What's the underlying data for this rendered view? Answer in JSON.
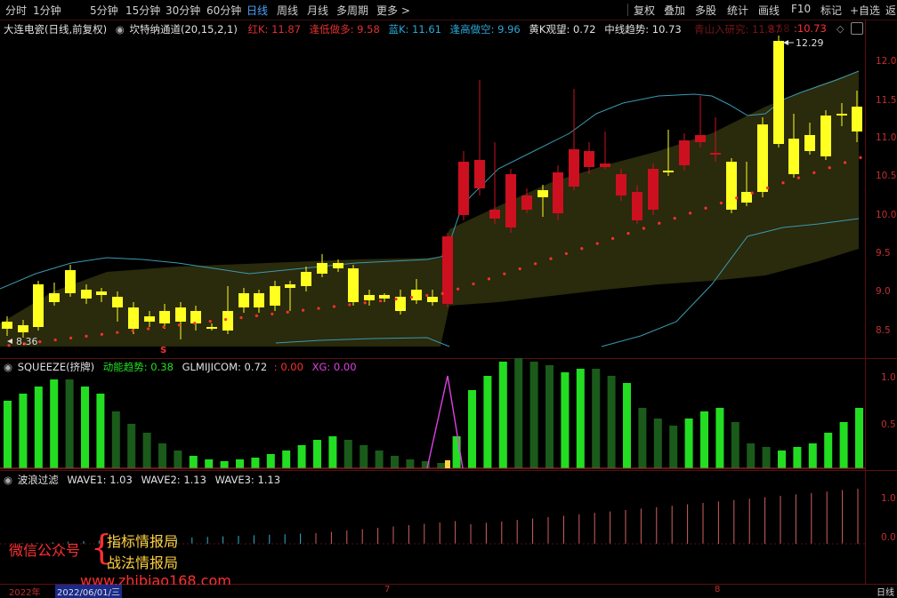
{
  "toolbar": {
    "left_tabs": [
      "分时",
      "1分钟",
      "5分钟",
      "15分钟",
      "30分钟",
      "60分钟",
      "日线",
      "周线",
      "月线",
      "多周期",
      "更多 >"
    ],
    "active_tab": "日线",
    "right_tabs": [
      "复权",
      "叠加",
      "多股",
      "统计",
      "画线",
      "F10",
      "标记",
      "+自选",
      "返"
    ]
  },
  "main_panel": {
    "title": "大连电瓷(日线,前复权)",
    "indicator": "坎特纳通道(20,15,2,1)",
    "values": [
      {
        "label": "红K: 11.87",
        "color": "#e03030"
      },
      {
        "label": "逢低做多: 9.58",
        "color": "#e03030"
      },
      {
        "label": "蓝K: 11.61",
        "color": "#2aa8d8"
      },
      {
        "label": "逢高做空: 9.96",
        "color": "#2aa8d8"
      },
      {
        "label": "黄K观望: 0.72",
        "color": "#e0e0e0"
      },
      {
        "label": "中线趋势: 10.73",
        "color": "#e0e0e0"
      },
      {
        "label": "青山入研究: 11.87",
        "color": "#ff3030"
      },
      {
        "label": "9.58",
        "color": "#aa2020"
      },
      {
        "label": ":10.73",
        "color": "#ff3030"
      }
    ],
    "high_label": "12.29",
    "low_label": "8.36",
    "axis_labels": [
      "12.0",
      "11.5",
      "11.0",
      "10.5",
      "10.0",
      "9.5",
      "9.0",
      "8.5"
    ],
    "marker": "S"
  },
  "squeeze_panel": {
    "title": "SQUEEZE(挤牌)",
    "values": [
      {
        "label": "动能趋势: 0.38",
        "color": "#20e020"
      },
      {
        "label": "GLMIJICOM: 0.72",
        "color": "#e0e0e0"
      },
      {
        "label": ": 0.00",
        "color": "#ff3030"
      },
      {
        "label": "XG: 0.00",
        "color": "#e040e0"
      }
    ],
    "axis_labels": [
      "1.0",
      "0.5"
    ]
  },
  "wave_panel": {
    "title": "波浪过滤",
    "values": [
      {
        "label": "WAVE1: 1.03",
        "color": "#e0e0e0"
      },
      {
        "label": "WAVE2: 1.13",
        "color": "#e0e0e0"
      },
      {
        "label": "WAVE3: 1.13",
        "color": "#e0e0e0"
      }
    ],
    "axis_labels": [
      "1.0",
      "0.0"
    ]
  },
  "watermark": {
    "left": "微信公众号",
    "line1": "指标情报局",
    "line2": "战法情报局",
    "url": "www.zhibiao168.com"
  },
  "bottom_axis": {
    "year": "2022年",
    "date": "2022/06/01/三",
    "month7": "7",
    "month8": "8",
    "period": "日线"
  }
}
